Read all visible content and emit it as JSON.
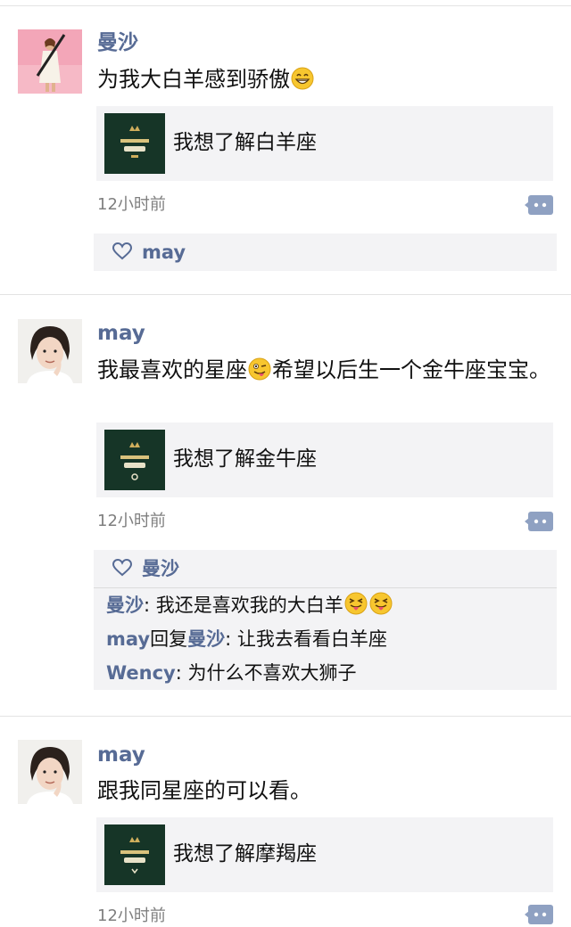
{
  "posts": [
    {
      "author": "曼沙",
      "text": "为我大白羊感到骄傲",
      "card_title": "我想了解白羊座",
      "time": "12小时前",
      "likes": "may",
      "comments": []
    },
    {
      "author": "may",
      "text_before_emoji": "我最喜欢的星座",
      "text_after_emoji": "希望以后生一个金牛座宝宝。",
      "card_title": "我想了解金牛座",
      "time": "12小时前",
      "likes": "曼沙",
      "comments": [
        {
          "name": "曼沙",
          "separator": ": ",
          "text": "我还是喜欢我的大白羊"
        },
        {
          "name": "may",
          "reply_word": "回复",
          "reply_to": "曼沙",
          "separator": ": ",
          "text": "让我去看看白羊座"
        },
        {
          "name": "Wency",
          "separator": ": ",
          "text": "为什么不喜欢大狮子"
        }
      ]
    },
    {
      "author": "may",
      "text": "跟我同星座的可以看。",
      "card_title": "我想了解摩羯座",
      "time": "12小时前"
    }
  ],
  "icons": {
    "emoji_grin": "grinning-face-emoji",
    "emoji_wink_tongue": "winking-tongue-emoji",
    "emoji_squint_tongue": "squinting-tongue-emoji",
    "heart": "heart-outline-icon",
    "comment": "comment-dots-icon"
  },
  "colors": {
    "name_link": "#576b95",
    "panel_bg": "#f3f3f5",
    "time_text": "#7f7f7f",
    "divider": "#e3e3e3"
  }
}
